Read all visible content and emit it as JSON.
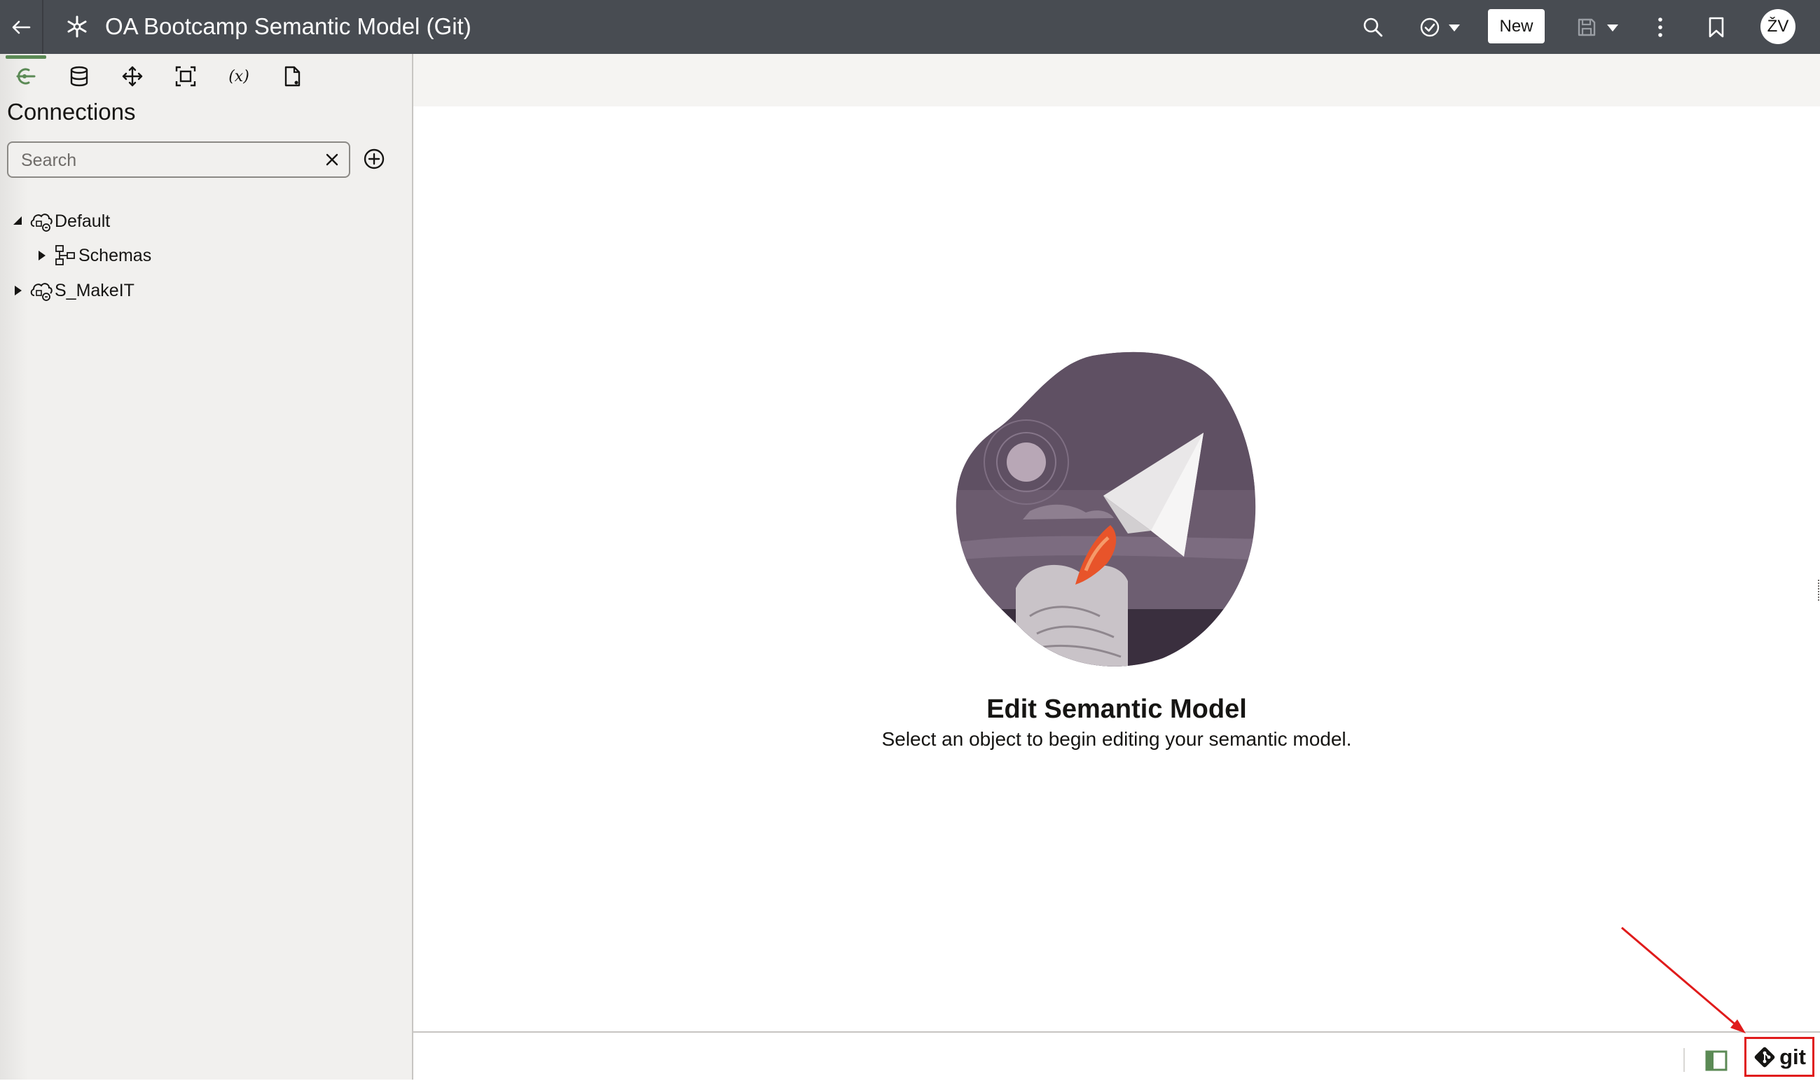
{
  "header": {
    "title": "OA Bootcamp Semantic Model (Git)",
    "new_label": "New",
    "avatar_initials": "ŽV"
  },
  "left_panel": {
    "tabs": [
      {
        "icon": "connections-icon",
        "active": true
      },
      {
        "icon": "database-icon"
      },
      {
        "icon": "move-icon"
      },
      {
        "icon": "frame-icon"
      },
      {
        "icon": "variable-icon",
        "text": "(x)"
      },
      {
        "icon": "document-icon"
      }
    ],
    "title": "Connections",
    "search": {
      "placeholder": "Search",
      "value": ""
    },
    "tree": [
      {
        "label": "Default",
        "expanded": true,
        "children": [
          {
            "label": "Schemas",
            "expanded": false
          }
        ]
      },
      {
        "label": "S_MakeIT",
        "expanded": false
      }
    ]
  },
  "main": {
    "empty_title": "Edit Semantic Model",
    "empty_subtitle": "Select an object to begin editing your semantic model."
  },
  "statusbar": {
    "git_label": "git"
  },
  "colors": {
    "header_bg": "#484c52",
    "active_tab": "#5b8a55",
    "annotation": "#e01b1b",
    "illustration_bg": "#6b5b6e",
    "flame": "#e8542a"
  }
}
